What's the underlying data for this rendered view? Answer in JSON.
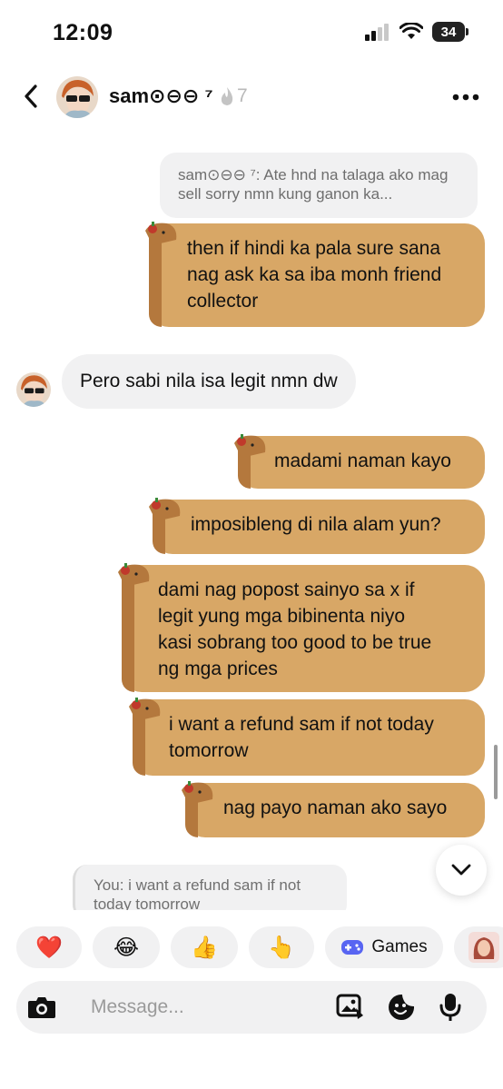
{
  "status_bar": {
    "time": "12:09",
    "battery": "34"
  },
  "header": {
    "username": "sam⊙⊖⊖ ⁷",
    "streak_count": "7"
  },
  "messages": {
    "quote_1": "sam⊙⊖⊖ ⁷: Ate hnd na talaga ako mag sell sorry nmn kung ganon ka...",
    "sent_1": [
      "then if hindi ka pala sure sana",
      "nag ask ka sa iba monh friend",
      "collector"
    ],
    "received_1": "Pero sabi nila isa legit nmn dw",
    "sent_2": "madami naman kayo",
    "sent_3": "imposibleng di nila alam yun?",
    "sent_4": [
      "dami nag popost sainyo sa x if",
      "legit yung mga bibinenta niyo",
      "kasi sobrang too good to be true",
      "ng mga prices"
    ],
    "sent_5": [
      "i want a refund sam if not today",
      "tomorrow"
    ],
    "sent_6": "nag payo naman ako sayo",
    "quote_2": "You: i want a refund sam if not today tomorrow"
  },
  "quick_reactions": {
    "heart": "❤️",
    "laugh": "😂",
    "thumbs": "👍",
    "point": "👆",
    "games_label": "Games"
  },
  "composer": {
    "placeholder": "Message..."
  },
  "colors": {
    "bubble": "#d8a766",
    "bubble_shadow": "#b4783d",
    "received": "#f1f1f2",
    "games": "#5865f2"
  }
}
